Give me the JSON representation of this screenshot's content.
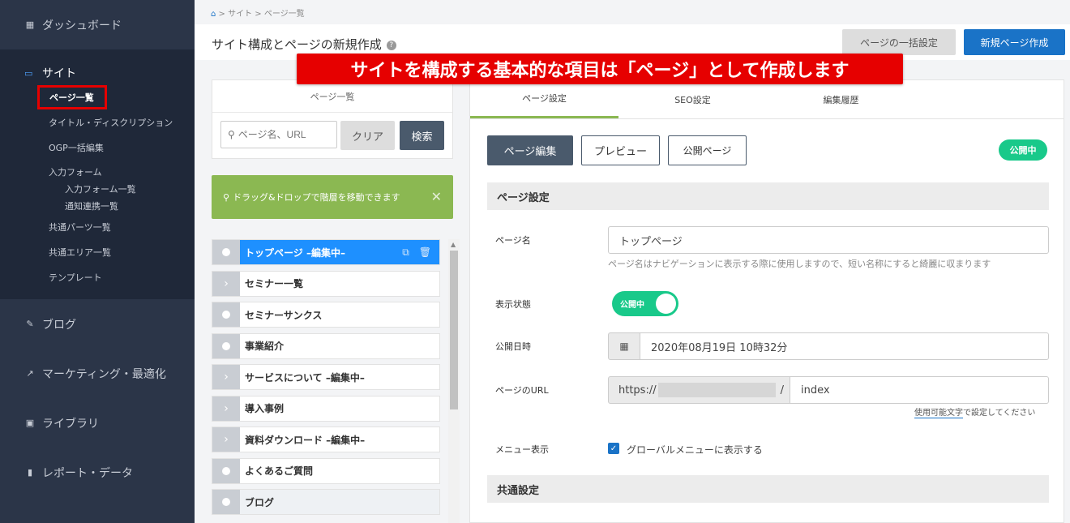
{
  "sidebar": {
    "dashboard": {
      "label": "ダッシュボード",
      "icon": "dashboard-icon"
    },
    "site": {
      "label": "サイト",
      "icon": "site-icon"
    },
    "site_items": [
      {
        "label": "ページ一覧",
        "active": true
      },
      {
        "label": "タイトル・ディスクリプション"
      },
      {
        "label": "OGP一括編集"
      },
      {
        "label": "入力フォーム"
      },
      {
        "label": "入力フォーム一覧"
      },
      {
        "label": "通知連携一覧"
      },
      {
        "label": "共通パーツ一覧"
      },
      {
        "label": "共通エリア一覧"
      },
      {
        "label": "テンプレート"
      }
    ],
    "blog": {
      "label": "ブログ",
      "icon": "pencil-icon"
    },
    "marketing": {
      "label": "マーケティング・最適化",
      "icon": "trend-icon"
    },
    "library": {
      "label": "ライブラリ",
      "icon": "image-icon"
    },
    "report": {
      "label": "レポート・データ",
      "icon": "bar-chart-icon"
    }
  },
  "breadcrumb": [
    "サイト",
    "ページ一覧"
  ],
  "header": {
    "title": "サイト構成とページの新規作成",
    "bulk_label": "ページの一括設定",
    "new_label": "新規ページ作成"
  },
  "banner": "サイトを構成する基本的な項目は「ページ」として作成します",
  "left_panel": {
    "title": "ページ一覧",
    "search_placeholder": "ページ名、URL",
    "clear_label": "クリア",
    "search_label": "検索",
    "tip": "ドラッグ&ドロップで階層を移動できます",
    "pages": [
      {
        "label": "トップページ –編集中–",
        "selected": true,
        "handle": "dot"
      },
      {
        "label": "セミナー一覧",
        "handle": "chevron"
      },
      {
        "label": "セミナーサンクス",
        "handle": "dot"
      },
      {
        "label": "事業紹介",
        "handle": "dot"
      },
      {
        "label": "サービスについて –編集中–",
        "handle": "chevron"
      },
      {
        "label": "導入事例",
        "handle": "chevron"
      },
      {
        "label": "資料ダウンロード –編集中–",
        "handle": "chevron"
      },
      {
        "label": "よくあるご質問",
        "handle": "dot"
      },
      {
        "label": "ブログ",
        "handle": "dot"
      }
    ]
  },
  "tabs": [
    "ページ設定",
    "SEO設定",
    "編集履歴"
  ],
  "actions": {
    "edit_label": "ページ編集",
    "preview_label": "プレビュー",
    "public_label": "公開ページ",
    "status_badge": "公開中"
  },
  "form": {
    "section1": "ページ設定",
    "page_name_label": "ページ名",
    "page_name_value": "トップページ",
    "page_name_hint": "ページ名はナビゲーションに表示する際に使用しますので、短い名称にすると綺麗に収まります",
    "visibility_label": "表示状態",
    "visibility_value": "公開中",
    "publish_date_label": "公開日時",
    "publish_date_value": "2020年08月19日 10時32分",
    "url_label": "ページのURL",
    "url_prefix": "https://",
    "url_suffix": "/",
    "url_value": "index",
    "url_hint_link": "使用可能文字",
    "url_hint_rest": "で設定してください",
    "menu_label": "メニュー表示",
    "menu_checkbox_label": "グローバルメニューに表示する",
    "section2": "共通設定"
  },
  "colors": {
    "sidebar_bg": "#2b3548",
    "primary": "#1a73c7",
    "selected_row": "#1e90ff",
    "success": "#19c98a",
    "tip_bg": "#8bb852",
    "banner": "#e60000"
  }
}
